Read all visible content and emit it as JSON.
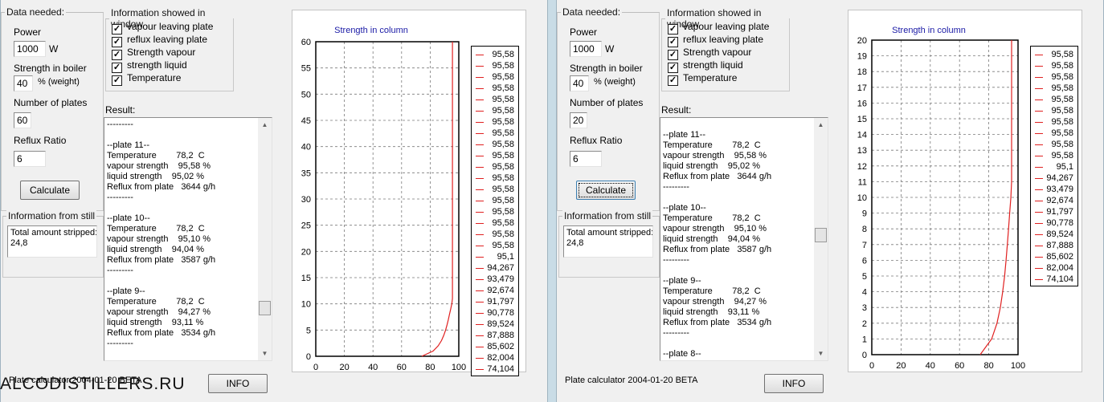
{
  "watermark": "ALCODISTILLERS.RU",
  "colors": {
    "curve": "#e02020",
    "title": "#1a1aa6",
    "grid": "#7a7a7a"
  },
  "windows": [
    {
      "id": "left",
      "data_needed": {
        "legend": "Data needed:",
        "power_label": "Power",
        "power_value": "1000",
        "power_unit": "W",
        "strength_label": "Strength in  boiler",
        "strength_value": "40",
        "strength_unit": "% (weight)",
        "plates_label": "Number of plates",
        "plates_value": "60",
        "reflux_label": "Reflux Ratio",
        "reflux_value": "6",
        "calculate_label": "Calculate"
      },
      "info_window": {
        "legend": "Information showed in window",
        "options": [
          {
            "label": "vapour leaving plate",
            "checked": "✓"
          },
          {
            "label": "reflux leaving plate",
            "checked": "✓"
          },
          {
            "label": "Strength vapour",
            "checked": "✓"
          },
          {
            "label": "strength liquid",
            "checked": "✓"
          },
          {
            "label": "Temperature",
            "checked": "✓"
          }
        ]
      },
      "result_label": "Result:",
      "result_text": "---------\n\n--plate 11--\nTemperature        78,2  C\nvapour strength    95,58 %\nliquid strength    95,02 %\nReflux from plate   3644 g/h\n---------\n\n--plate 10--\nTemperature        78,2  C\nvapour strength    95,10 %\nliquid strength    94,04 %\nReflux from plate   3587 g/h\n---------\n\n--plate 9--\nTemperature        78,2  C\nvapour strength    94,27 %\nliquid strength    93,11 %\nReflux from plate   3534 g/h\n---------",
      "still": {
        "legend": "Information from still",
        "text": "Total amount stripped:\n24,8"
      },
      "footer": "Plate calculator 2004-01-20 BETA",
      "info_button": "INFO",
      "legend_values": [
        "95,58",
        "95,58",
        "95,58",
        "95,58",
        "95,58",
        "95,58",
        "95,58",
        "95,58",
        "95,58",
        "95,58",
        "95,58",
        "95,58",
        "95,58",
        "95,58",
        "95,58",
        "95,58",
        "95,58",
        "95,58",
        "95,1",
        "94,267",
        "93,479",
        "92,674",
        "91,797",
        "90,778",
        "89,524",
        "87,888",
        "85,602",
        "82,004",
        "74,104"
      ]
    },
    {
      "id": "right",
      "data_needed": {
        "legend": "Data needed:",
        "power_label": "Power",
        "power_value": "1000",
        "power_unit": "W",
        "strength_label": "Strength in  boiler",
        "strength_value": "40",
        "strength_unit": "% (weight)",
        "plates_label": "Number of plates",
        "plates_value": "20",
        "reflux_label": "Reflux Ratio",
        "reflux_value": "6",
        "calculate_label": "Calculate"
      },
      "info_window": {
        "legend": "Information showed in window",
        "options": [
          {
            "label": "vapour leaving plate",
            "checked": "✓"
          },
          {
            "label": "reflux leaving plate",
            "checked": "✓"
          },
          {
            "label": "Strength vapour",
            "checked": "✓"
          },
          {
            "label": "strength liquid",
            "checked": "✓"
          },
          {
            "label": "Temperature",
            "checked": "✓"
          }
        ]
      },
      "result_label": "Result:",
      "result_text": "\n--plate 11--\nTemperature        78,2  C\nvapour strength    95,58 %\nliquid strength    95,02 %\nReflux from plate   3644 g/h\n---------\n\n--plate 10--\nTemperature        78,2  C\nvapour strength    95,10 %\nliquid strength    94,04 %\nReflux from plate   3587 g/h\n---------\n\n--plate 9--\nTemperature        78,2  C\nvapour strength    94,27 %\nliquid strength    93,11 %\nReflux from plate   3534 g/h\n---------\n\n--plate 8--",
      "still": {
        "legend": "Information from still",
        "text": "Total amount stripped:\n24,8"
      },
      "footer": "Plate calculator 2004-01-20 BETA",
      "info_button": "INFO",
      "legend_values": [
        "95,58",
        "95,58",
        "95,58",
        "95,58",
        "95,58",
        "95,58",
        "95,58",
        "95,58",
        "95,58",
        "95,58",
        "95,1",
        "94,267",
        "93,479",
        "92,674",
        "91,797",
        "90,778",
        "89,524",
        "87,888",
        "85,602",
        "82,004",
        "74,104"
      ]
    }
  ],
  "chart_data": [
    {
      "type": "line",
      "title": "Strength in column",
      "xlim": [
        0,
        100
      ],
      "ylim": [
        0,
        60
      ],
      "xticks": [
        0,
        20,
        40,
        60,
        80,
        100
      ],
      "yticks": [
        0,
        5,
        10,
        15,
        20,
        25,
        30,
        35,
        40,
        45,
        50,
        55,
        60
      ],
      "grid": true,
      "legend_position": "right",
      "series": [
        {
          "x": [
            74.1,
            82.0,
            85.6,
            87.9,
            89.5,
            90.8,
            91.8,
            92.7,
            93.5,
            94.3,
            95.1,
            95.58,
            95.58,
            95.58
          ],
          "y": [
            0,
            1,
            2,
            3,
            4,
            5,
            6,
            7,
            8,
            9,
            10,
            11,
            30,
            60
          ]
        }
      ]
    },
    {
      "type": "line",
      "title": "Strength in column",
      "xlim": [
        0,
        100
      ],
      "ylim": [
        0,
        20
      ],
      "xticks": [
        0,
        20,
        40,
        60,
        80,
        100
      ],
      "yticks": [
        0,
        1,
        2,
        3,
        4,
        5,
        6,
        7,
        8,
        9,
        10,
        11,
        12,
        13,
        14,
        15,
        16,
        17,
        18,
        19,
        20
      ],
      "grid": true,
      "legend_position": "right",
      "series": [
        {
          "x": [
            74.1,
            82.0,
            85.6,
            87.9,
            89.5,
            90.8,
            91.8,
            92.7,
            93.5,
            94.3,
            95.1,
            95.58,
            95.58,
            95.58
          ],
          "y": [
            0,
            1,
            2,
            3,
            4,
            5,
            6,
            7,
            8,
            9,
            10,
            11,
            15,
            20
          ]
        }
      ]
    }
  ]
}
